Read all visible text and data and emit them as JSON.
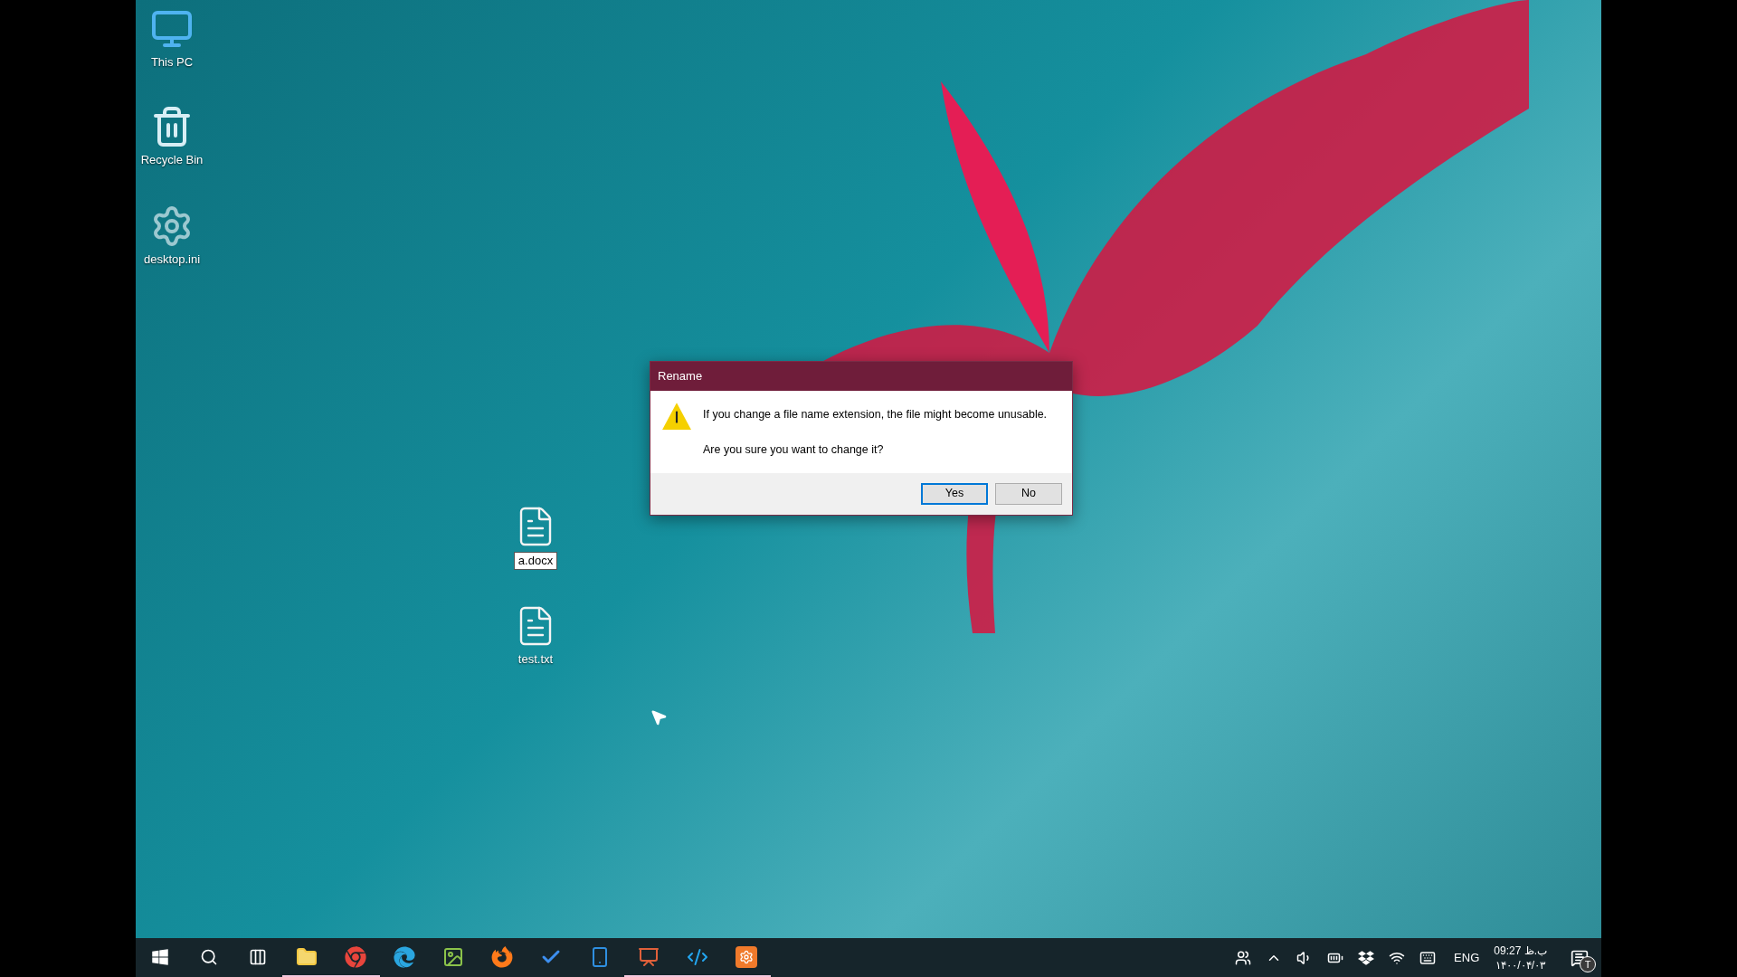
{
  "desktop_icons": [
    {
      "label": "This PC",
      "kind": "computer",
      "editing": false
    },
    {
      "label": "Recycle Bin",
      "kind": "recycle",
      "editing": false
    },
    {
      "label": "desktop.ini",
      "kind": "settings-file",
      "editing": false
    },
    {
      "label": "a.docx",
      "kind": "document",
      "editing": true
    },
    {
      "label": "test.txt",
      "kind": "document",
      "editing": false
    }
  ],
  "dialog": {
    "title": "Rename",
    "message": "If you change a file name extension, the file might become unusable.",
    "question": "Are you sure you want to change it?",
    "buttons": [
      {
        "label": "Yes",
        "default": true
      },
      {
        "label": "No",
        "default": false
      }
    ]
  },
  "taskbar": {
    "apps": [
      {
        "kind": "start",
        "running": false
      },
      {
        "kind": "search",
        "running": false
      },
      {
        "kind": "task-view",
        "running": false
      },
      {
        "kind": "explorer",
        "running": true
      },
      {
        "kind": "chrome",
        "running": true
      },
      {
        "kind": "edge",
        "running": false
      },
      {
        "kind": "image-editor",
        "running": false
      },
      {
        "kind": "firefox",
        "running": false
      },
      {
        "kind": "todo",
        "running": false
      },
      {
        "kind": "phone",
        "running": false
      },
      {
        "kind": "slides",
        "running": true
      },
      {
        "kind": "vscode",
        "running": true
      },
      {
        "kind": "xampp",
        "running": true
      }
    ],
    "tray": [
      {
        "kind": "people"
      },
      {
        "kind": "chevron"
      },
      {
        "kind": "volume"
      },
      {
        "kind": "battery"
      },
      {
        "kind": "dropbox"
      },
      {
        "kind": "wifi"
      },
      {
        "kind": "keyboard"
      }
    ],
    "language": "ENG",
    "time": "09:27 ب.ظ",
    "date": "۱۴۰۰/۰۴/۰۳",
    "notification_badge": "T"
  }
}
